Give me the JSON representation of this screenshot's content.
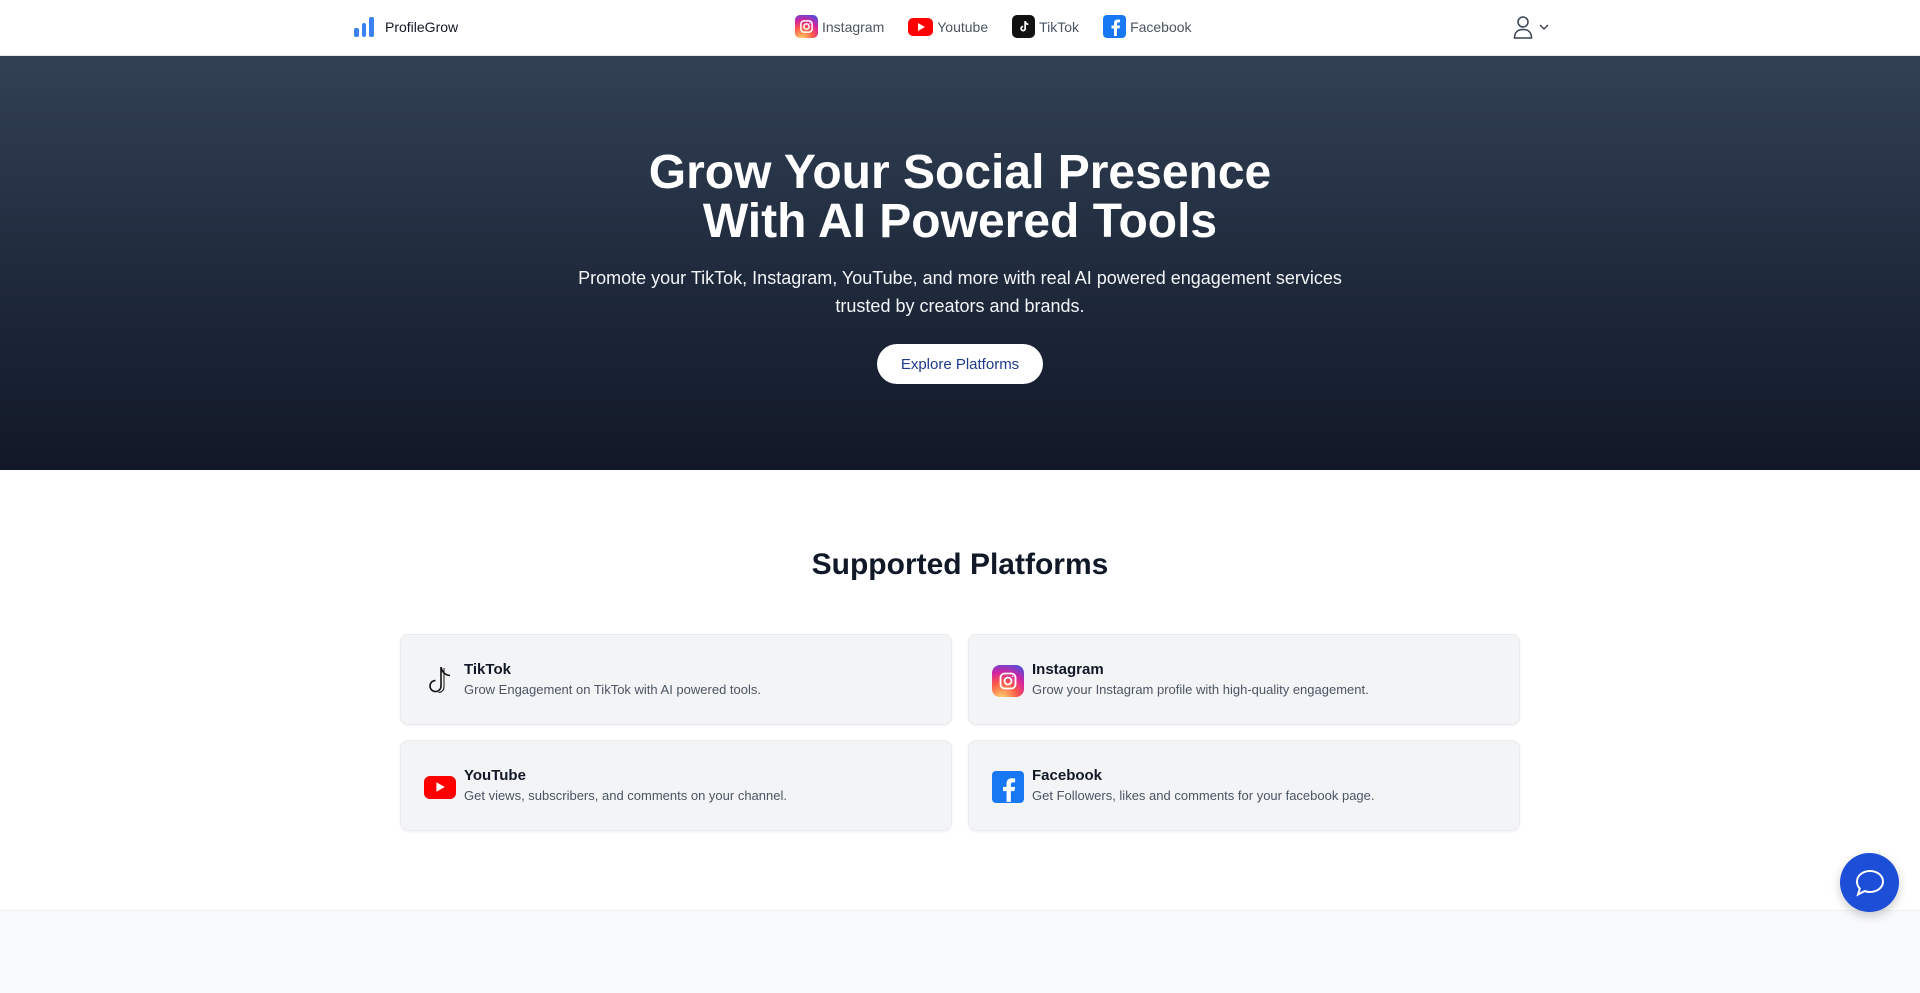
{
  "brand": {
    "name": "ProfileGrow",
    "accent": "#3b82f6"
  },
  "nav": {
    "items": [
      {
        "label": "Instagram",
        "icon": "instagram-icon"
      },
      {
        "label": "Youtube",
        "icon": "youtube-icon"
      },
      {
        "label": "TikTok",
        "icon": "tiktok-icon"
      },
      {
        "label": "Facebook",
        "icon": "facebook-icon"
      }
    ]
  },
  "user_menu": {
    "icon": "user-icon",
    "caret": "chevron-down-icon"
  },
  "hero": {
    "title_line1": "Grow Your Social Presence",
    "title_line2": "With AI Powered Tools",
    "subtitle": "Promote your TikTok, Instagram, YouTube, and more with real AI powered engagement services trusted by creators and brands.",
    "cta_label": "Explore Platforms"
  },
  "platforms": {
    "title": "Supported Platforms",
    "cards": [
      {
        "name": "TikTok",
        "description": "Grow Engagement on TikTok with AI powered tools.",
        "icon": "tiktok-icon"
      },
      {
        "name": "Instagram",
        "description": "Grow your Instagram profile with high-quality engagement.",
        "icon": "instagram-icon"
      },
      {
        "name": "YouTube",
        "description": "Get views, subscribers, and comments on your channel.",
        "icon": "youtube-icon"
      },
      {
        "name": "Facebook",
        "description": "Get Followers, likes and comments for your facebook page.",
        "icon": "facebook-icon"
      }
    ]
  },
  "chat": {
    "icon": "chat-icon",
    "color": "#1d4ed8"
  }
}
